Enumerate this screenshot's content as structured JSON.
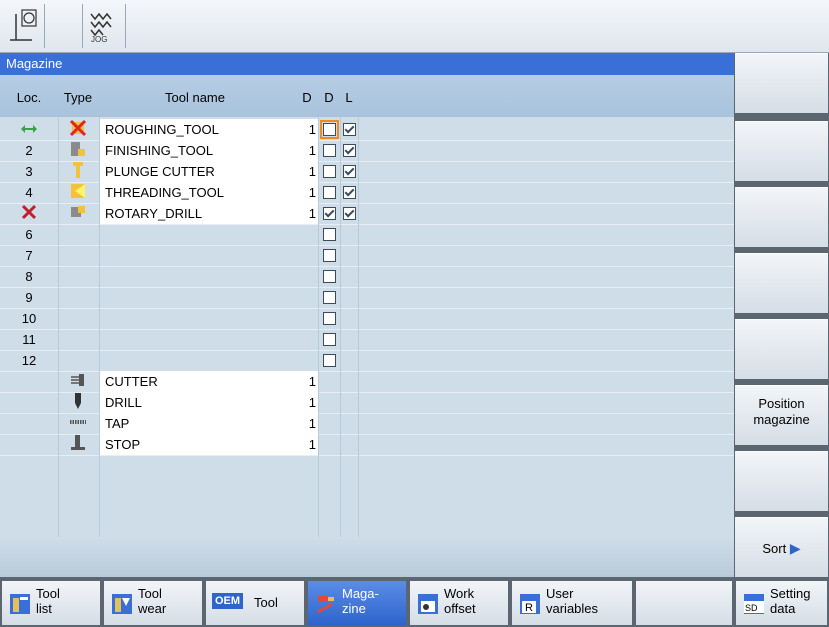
{
  "top_bar": {
    "jog_label": "JOG"
  },
  "window": {
    "title": "Magazine"
  },
  "table": {
    "columns": [
      "Loc.",
      "Type",
      "Tool name",
      "D",
      "D",
      "L"
    ],
    "rows": [
      {
        "loc": "",
        "loc_icon": "load-position-arrows-icon",
        "type_icon": "roughing-tool-red-x-icon",
        "name": "ROUGHING_TOOL",
        "d": "1",
        "d_checked": false,
        "d_focus": true,
        "l_checked": true
      },
      {
        "loc": "2",
        "type_icon": "finishing-tool-icon",
        "name": "FINISHING_TOOL",
        "d": "1",
        "d_checked": false,
        "l_checked": true
      },
      {
        "loc": "3",
        "type_icon": "plunge-cutter-icon",
        "name": "PLUNGE CUTTER",
        "d": "1",
        "d_checked": false,
        "l_checked": true
      },
      {
        "loc": "4",
        "type_icon": "threading-tool-icon",
        "name": "THREADING_TOOL",
        "d": "1",
        "d_checked": false,
        "l_checked": true
      },
      {
        "loc": "",
        "loc_icon": "disabled-location-x-icon",
        "type_icon": "rotary-drill-icon",
        "name": "ROTARY_DRILL",
        "d": "1",
        "d_checked": true,
        "l_checked": true
      },
      {
        "loc": "6",
        "d_checked": false
      },
      {
        "loc": "7",
        "d_checked": false
      },
      {
        "loc": "8",
        "d_checked": false
      },
      {
        "loc": "9",
        "d_checked": false
      },
      {
        "loc": "10",
        "d_checked": false
      },
      {
        "loc": "11",
        "d_checked": false
      },
      {
        "loc": "12",
        "d_checked": false
      },
      {
        "loc": "",
        "type_icon": "cutter-icon",
        "name": "CUTTER",
        "d": "1"
      },
      {
        "loc": "",
        "type_icon": "drill-icon",
        "name": "DRILL",
        "d": "1"
      },
      {
        "loc": "",
        "type_icon": "tap-icon",
        "name": "TAP",
        "d": "1"
      },
      {
        "loc": "",
        "type_icon": "stop-icon",
        "name": "STOP",
        "d": "1"
      }
    ]
  },
  "vertical_softkeys": [
    {
      "label": ""
    },
    {
      "label": ""
    },
    {
      "label": ""
    },
    {
      "label": ""
    },
    {
      "label": ""
    },
    {
      "label": "Position magazine"
    },
    {
      "label": ""
    },
    {
      "label": "Sort"
    }
  ],
  "horizontal_softkeys": [
    {
      "label": "Tool list",
      "icon": "tool-list-icon"
    },
    {
      "label": "Tool wear",
      "icon": "tool-wear-icon"
    },
    {
      "label": "Tool",
      "icon": "oem-icon",
      "icon_text": "OEM"
    },
    {
      "label": "Maga- zine",
      "icon": "magazine-icon",
      "active": true
    },
    {
      "label": "Work offset",
      "icon": "work-offset-icon"
    },
    {
      "label": "User variables",
      "icon": "user-variables-icon",
      "icon_text": "R"
    },
    {
      "label": "",
      "icon": ""
    },
    {
      "label": "Setting data",
      "icon": "setting-data-icon",
      "icon_text": "SD"
    }
  ],
  "colors": {
    "title_bar": "#3a6fd8",
    "header": "#b6cde3",
    "table_bg": "#cfdde9",
    "focus_orange": "#f08a1d",
    "active_key": "#2e64cc"
  }
}
